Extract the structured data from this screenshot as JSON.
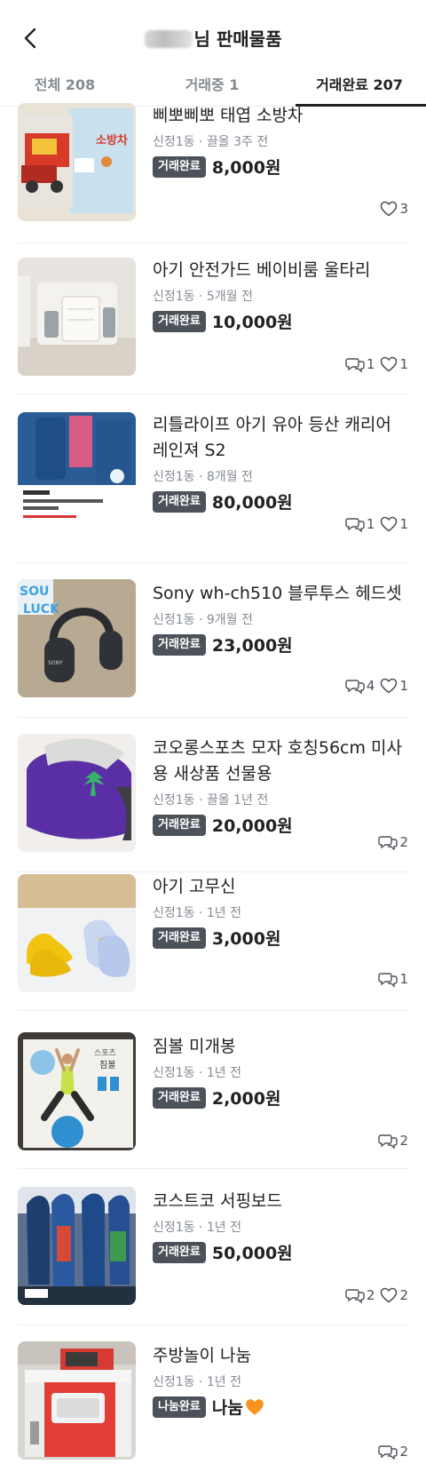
{
  "header": {
    "title_suffix": "님 판매물품"
  },
  "tabs": [
    {
      "label": "전체 208"
    },
    {
      "label": "거래중 1"
    },
    {
      "label": "거래완료 207"
    }
  ],
  "items": [
    {
      "name": "삐뽀삐뽀 태엽 소방차",
      "meta": "신정1동 · 끌올 3주 전",
      "badge": "거래완료",
      "price": "8,000원",
      "chats": "",
      "likes": "3",
      "image": "toy-fire-truck"
    },
    {
      "name": "아기 안전가드 베이비룸 울타리",
      "meta": "신정1동 · 5개월 전",
      "badge": "거래완료",
      "price": "10,000원",
      "chats": "1",
      "likes": "1",
      "image": "baby-room-fence"
    },
    {
      "name": "리틀라이프 아기 유아 등산 캐리어 레인져 S2",
      "meta": "신정1동 · 8개월 전",
      "badge": "거래완료",
      "price": "80,000원",
      "chats": "1",
      "likes": "1",
      "image": "baby-carrier"
    },
    {
      "name": "Sony wh-ch510 블루투스 헤드셋",
      "meta": "신정1동 · 9개월 전",
      "badge": "거래완료",
      "price": "23,000원",
      "chats": "4",
      "likes": "1",
      "image": "headphones"
    },
    {
      "name": "코오롱스포츠 모자 호칭56cm 미사용 새상품 선물용",
      "meta": "신정1동 · 끌올 1년 전",
      "badge": "거래완료",
      "price": "20,000원",
      "chats": "2",
      "likes": "",
      "image": "cap"
    },
    {
      "name": "아기 고무신",
      "meta": "신정1동 · 1년 전",
      "badge": "거래완료",
      "price": "3,000원",
      "chats": "1",
      "likes": "",
      "image": "baby-shoes"
    },
    {
      "name": "짐볼 미개봉",
      "meta": "신정1동 · 1년 전",
      "badge": "거래완료",
      "price": "2,000원",
      "chats": "2",
      "likes": "",
      "image": "gym-ball"
    },
    {
      "name": "코스트코 서핑보드",
      "meta": "신정1동 · 1년 전",
      "badge": "거래완료",
      "price": "50,000원",
      "chats": "2",
      "likes": "2",
      "image": "surfboard"
    },
    {
      "name": "주방놀이  나눔",
      "meta": "신정1동 · 1년 전",
      "badge": "나눔완료",
      "price": "나눔",
      "chats": "2",
      "likes": "",
      "image": "play-kitchen"
    }
  ]
}
